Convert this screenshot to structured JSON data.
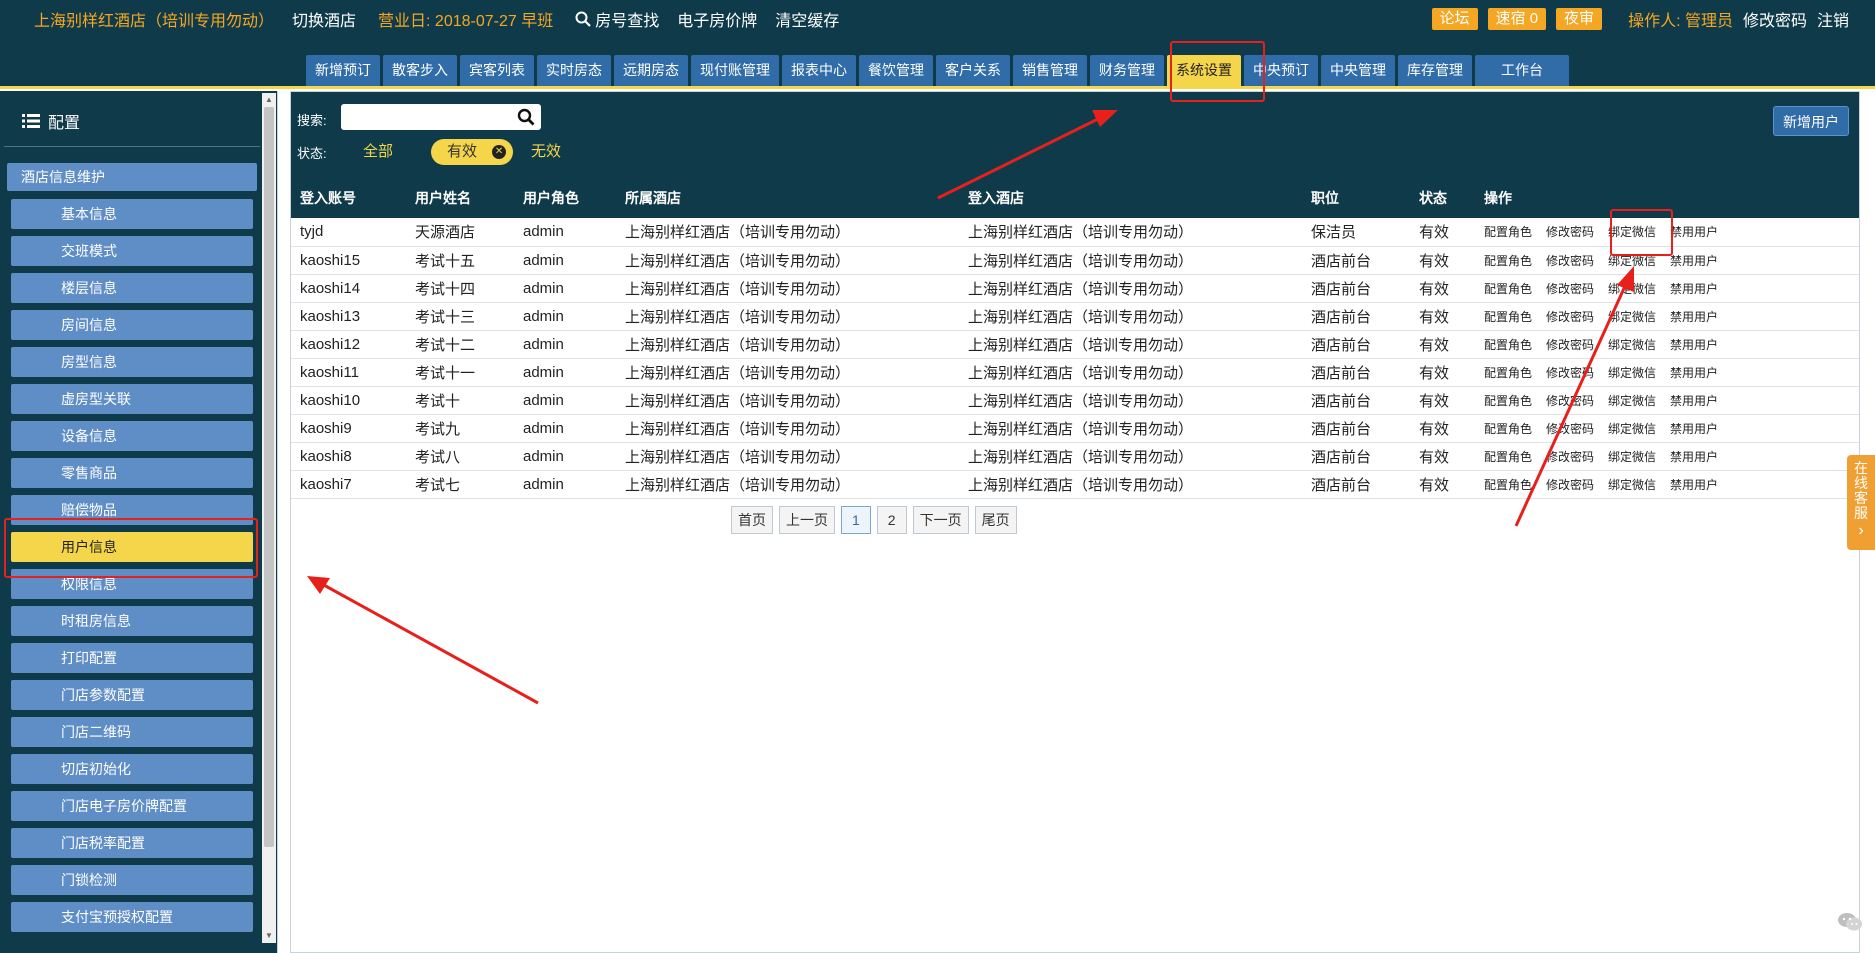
{
  "topbar": {
    "hotel_name": "上海别样红酒店（培训专用勿动）",
    "switch_hotel": "切换酒店",
    "business_date": "营业日: 2018-07-27 早班",
    "room_search": "房号查找",
    "e_price_board": "电子房价牌",
    "clear_cache": "清空缓存",
    "forum": "论坛",
    "quick_stay": "速宿 0",
    "night_audit": "夜审",
    "operator": "操作人: 管理员",
    "change_password": "修改密码",
    "logout": "注销"
  },
  "nav_tabs": [
    {
      "label": "新增预订"
    },
    {
      "label": "散客步入"
    },
    {
      "label": "宾客列表"
    },
    {
      "label": "实时房态"
    },
    {
      "label": "远期房态"
    },
    {
      "label": "现付账管理"
    },
    {
      "label": "报表中心"
    },
    {
      "label": "餐饮管理"
    },
    {
      "label": "客户关系"
    },
    {
      "label": "销售管理"
    },
    {
      "label": "财务管理"
    },
    {
      "label": "系统设置"
    },
    {
      "label": "中央预订"
    },
    {
      "label": "中央管理"
    },
    {
      "label": "库存管理"
    },
    {
      "label": "工作台"
    }
  ],
  "sidebar": {
    "title": "配置",
    "section": "酒店信息维护",
    "items": [
      {
        "label": "基本信息"
      },
      {
        "label": "交班模式"
      },
      {
        "label": "楼层信息"
      },
      {
        "label": "房间信息"
      },
      {
        "label": "房型信息"
      },
      {
        "label": "虚房型关联"
      },
      {
        "label": "设备信息"
      },
      {
        "label": "零售商品"
      },
      {
        "label": "赔偿物品"
      },
      {
        "label": "用户信息"
      },
      {
        "label": "权限信息"
      },
      {
        "label": "时租房信息"
      },
      {
        "label": "打印配置"
      },
      {
        "label": "门店参数配置"
      },
      {
        "label": "门店二维码"
      },
      {
        "label": "切店初始化"
      },
      {
        "label": "门店电子房价牌配置"
      },
      {
        "label": "门店税率配置"
      },
      {
        "label": "门锁检测"
      },
      {
        "label": "支付宝预授权配置"
      }
    ]
  },
  "filter": {
    "search_label": "搜索:",
    "search_value": "",
    "status_label": "状态:",
    "status_all": "全部",
    "status_valid": "有效",
    "status_invalid": "无效",
    "add_user": "新增用户"
  },
  "table": {
    "headers": [
      "登入账号",
      "用户姓名",
      "用户角色",
      "所属酒店",
      "登入酒店",
      "职位",
      "状态",
      "操作"
    ],
    "op_labels": [
      "配置角色",
      "修改密码",
      "绑定微信",
      "禁用用户"
    ],
    "rows": [
      {
        "account": "tyjd",
        "name": "天源酒店",
        "role": "admin",
        "hotel": "上海别样红酒店（培训专用勿动）",
        "login_hotel": "上海别样红酒店（培训专用勿动）",
        "position": "保洁员",
        "status": "有效"
      },
      {
        "account": "kaoshi15",
        "name": "考试十五",
        "role": "admin",
        "hotel": "上海别样红酒店（培训专用勿动）",
        "login_hotel": "上海别样红酒店（培训专用勿动）",
        "position": "酒店前台",
        "status": "有效"
      },
      {
        "account": "kaoshi14",
        "name": "考试十四",
        "role": "admin",
        "hotel": "上海别样红酒店（培训专用勿动）",
        "login_hotel": "上海别样红酒店（培训专用勿动）",
        "position": "酒店前台",
        "status": "有效"
      },
      {
        "account": "kaoshi13",
        "name": "考试十三",
        "role": "admin",
        "hotel": "上海别样红酒店（培训专用勿动）",
        "login_hotel": "上海别样红酒店（培训专用勿动）",
        "position": "酒店前台",
        "status": "有效"
      },
      {
        "account": "kaoshi12",
        "name": "考试十二",
        "role": "admin",
        "hotel": "上海别样红酒店（培训专用勿动）",
        "login_hotel": "上海别样红酒店（培训专用勿动）",
        "position": "酒店前台",
        "status": "有效"
      },
      {
        "account": "kaoshi11",
        "name": "考试十一",
        "role": "admin",
        "hotel": "上海别样红酒店（培训专用勿动）",
        "login_hotel": "上海别样红酒店（培训专用勿动）",
        "position": "酒店前台",
        "status": "有效"
      },
      {
        "account": "kaoshi10",
        "name": "考试十",
        "role": "admin",
        "hotel": "上海别样红酒店（培训专用勿动）",
        "login_hotel": "上海别样红酒店（培训专用勿动）",
        "position": "酒店前台",
        "status": "有效"
      },
      {
        "account": "kaoshi9",
        "name": "考试九",
        "role": "admin",
        "hotel": "上海别样红酒店（培训专用勿动）",
        "login_hotel": "上海别样红酒店（培训专用勿动）",
        "position": "酒店前台",
        "status": "有效"
      },
      {
        "account": "kaoshi8",
        "name": "考试八",
        "role": "admin",
        "hotel": "上海别样红酒店（培训专用勿动）",
        "login_hotel": "上海别样红酒店（培训专用勿动）",
        "position": "酒店前台",
        "status": "有效"
      },
      {
        "account": "kaoshi7",
        "name": "考试七",
        "role": "admin",
        "hotel": "上海别样红酒店（培训专用勿动）",
        "login_hotel": "上海别样红酒店（培训专用勿动）",
        "position": "酒店前台",
        "status": "有效"
      }
    ]
  },
  "pager": {
    "first": "首页",
    "prev": "上一页",
    "pages": [
      "1",
      "2"
    ],
    "current": "1",
    "next": "下一页",
    "last": "尾页"
  },
  "kefu": {
    "label": "在线客服",
    "arrow": "›"
  },
  "colors": {
    "header_bg": "#0f3a4a",
    "accent_yellow": "#f5d64a",
    "accent_orange": "#f5a623",
    "nav_blue": "#2f6ca8",
    "sidebar_item": "#5f8ec7",
    "annotation_red": "#e8201c"
  },
  "icons": {
    "search": "search-icon",
    "menu": "list-icon",
    "clear": "close-icon",
    "wechat": "wechat-icon"
  }
}
